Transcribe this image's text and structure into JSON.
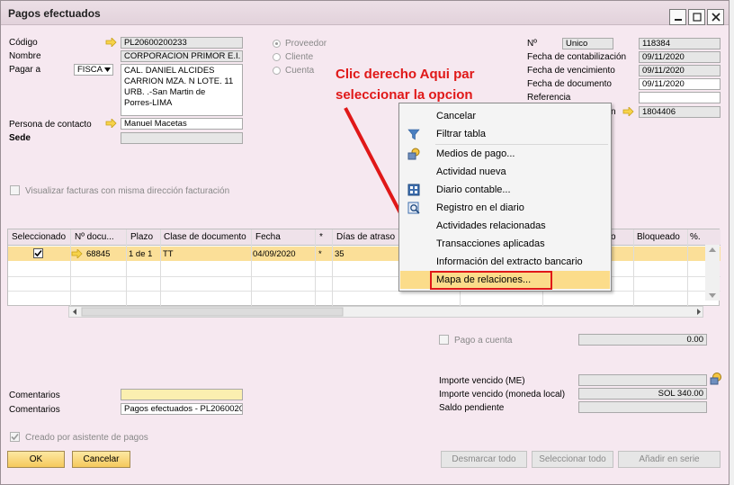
{
  "window": {
    "title": "Pagos efectuados"
  },
  "header": {
    "codigo_label": "Código",
    "codigo_value": "PL20600200233",
    "nombre_label": "Nombre",
    "nombre_value": "CORPORACION PRIMOR E.I.",
    "pagar_a_label": "Pagar a",
    "pagar_a_value": "FISCA",
    "address_lines": [
      "CAL. DANIEL ALCIDES",
      "CARRION MZA. N LOTE. 11",
      "URB. .-San Martin de",
      "Porres-LIMA"
    ],
    "persona_label": "Persona de contacto",
    "persona_value": "Manuel Macetas",
    "sede_label": "Sede",
    "radio_proveedor": "Proveedor",
    "radio_cliente": "Cliente",
    "radio_cuenta": "Cuenta"
  },
  "right_panel": {
    "no_label": "Nº",
    "no_series": "Unico",
    "no_value": "118384",
    "fecha_contab_label": "Fecha de contabilización",
    "fecha_contab_value": "09/11/2020",
    "fecha_venc_label": "Fecha de vencimiento",
    "fecha_venc_value": "09/11/2020",
    "fecha_doc_label": "Fecha de documento",
    "fecha_doc_value": "09/11/2020",
    "referencia_label": "Referencia",
    "transaccion_label": "n",
    "transaccion_value": "1804406"
  },
  "annotation": {
    "line1": "Clic derecho Aqui par",
    "line2": "seleccionar la opcion"
  },
  "visualizar_label": "Visualizar facturas con misma dirección facturación",
  "grid": {
    "headers": [
      "Seleccionado",
      "Nº docu...",
      "Plazo",
      "Clase de documento",
      "Fecha",
      "*",
      "Días de atraso",
      "o",
      "Bloqueado",
      "%."
    ],
    "row": {
      "doc": "68845",
      "plazo": "1 de 1",
      "clase": "TT",
      "fecha": "04/09/2020",
      "star": "*",
      "dias": "35"
    }
  },
  "context_menu": {
    "items": [
      {
        "label": "Cancelar",
        "icon": "none"
      },
      {
        "label": "Filtrar tabla",
        "icon": "filter-icon"
      },
      {
        "label": "Medios de pago...",
        "icon": "coins-icon"
      },
      {
        "label": "Actividad nueva",
        "icon": "none"
      },
      {
        "label": "Diario contable...",
        "icon": "journal-icon"
      },
      {
        "label": "Registro en el diario",
        "icon": "journal-preview-icon"
      },
      {
        "label": "Actividades relacionadas",
        "icon": "none"
      },
      {
        "label": "Transacciones aplicadas",
        "icon": "none"
      },
      {
        "label": "Información del extracto bancario",
        "icon": "none"
      },
      {
        "label": "Mapa de relaciones...",
        "icon": "none"
      }
    ]
  },
  "pago_a_cuenta_label": "Pago a cuenta",
  "pago_a_cuenta_value": "0.00",
  "totals": {
    "importe_me_label": "Importe vencido (ME)",
    "importe_local_label": "Importe vencido (moneda local)",
    "importe_local_value": "SOL 340.00",
    "saldo_label": "Saldo pendiente"
  },
  "comentarios_label": "Comentarios",
  "comentarios2_label": "Comentarios",
  "comentarios2_value": "Pagos efectuados - PL2060020",
  "creado_label": "Creado por asistente de pagos",
  "buttons": {
    "ok": "OK",
    "cancelar": "Cancelar",
    "desmarcar": "Desmarcar todo",
    "seleccionar": "Seleccionar todo",
    "anadir": "Añadir en serie"
  },
  "colors": {
    "accent": "#f5c95c",
    "annotation": "#e01818",
    "window_bg": "#f6e8f0"
  }
}
